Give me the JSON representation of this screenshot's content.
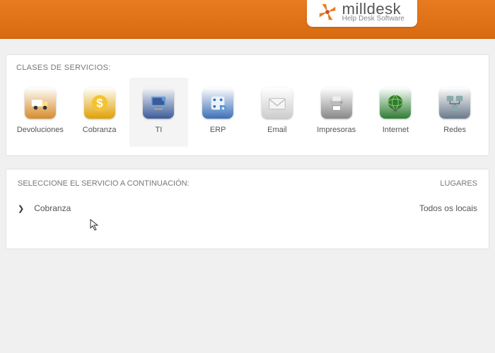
{
  "brand": {
    "name": "milldesk",
    "tagline": "Help Desk Software"
  },
  "categories": {
    "title": "CLASES DE SERVICIOS:",
    "items": [
      {
        "label": "Devoluciones",
        "icon": "truck",
        "bg": "#d88b2a"
      },
      {
        "label": "Cobranza",
        "icon": "dollar",
        "bg": "#e0a000"
      },
      {
        "label": "TI",
        "icon": "monitor",
        "bg": "#3b5b9a",
        "selected": true
      },
      {
        "label": "ERP",
        "icon": "erp",
        "bg": "#3e6fb8"
      },
      {
        "label": "Email",
        "icon": "envelope",
        "bg": "#cccccc"
      },
      {
        "label": "Impresoras",
        "icon": "printer",
        "bg": "#888888"
      },
      {
        "label": "Internet",
        "icon": "globe",
        "bg": "#2e7d32"
      },
      {
        "label": "Redes",
        "icon": "network",
        "bg": "#6a7a8a"
      }
    ]
  },
  "servicesPanel": {
    "title": "SELECCIONE EL SERVICIO A CONTINUACIÓN:",
    "placesTitle": "LUGARES",
    "row": {
      "name": "Cobranza",
      "place": "Todos os locais"
    }
  }
}
